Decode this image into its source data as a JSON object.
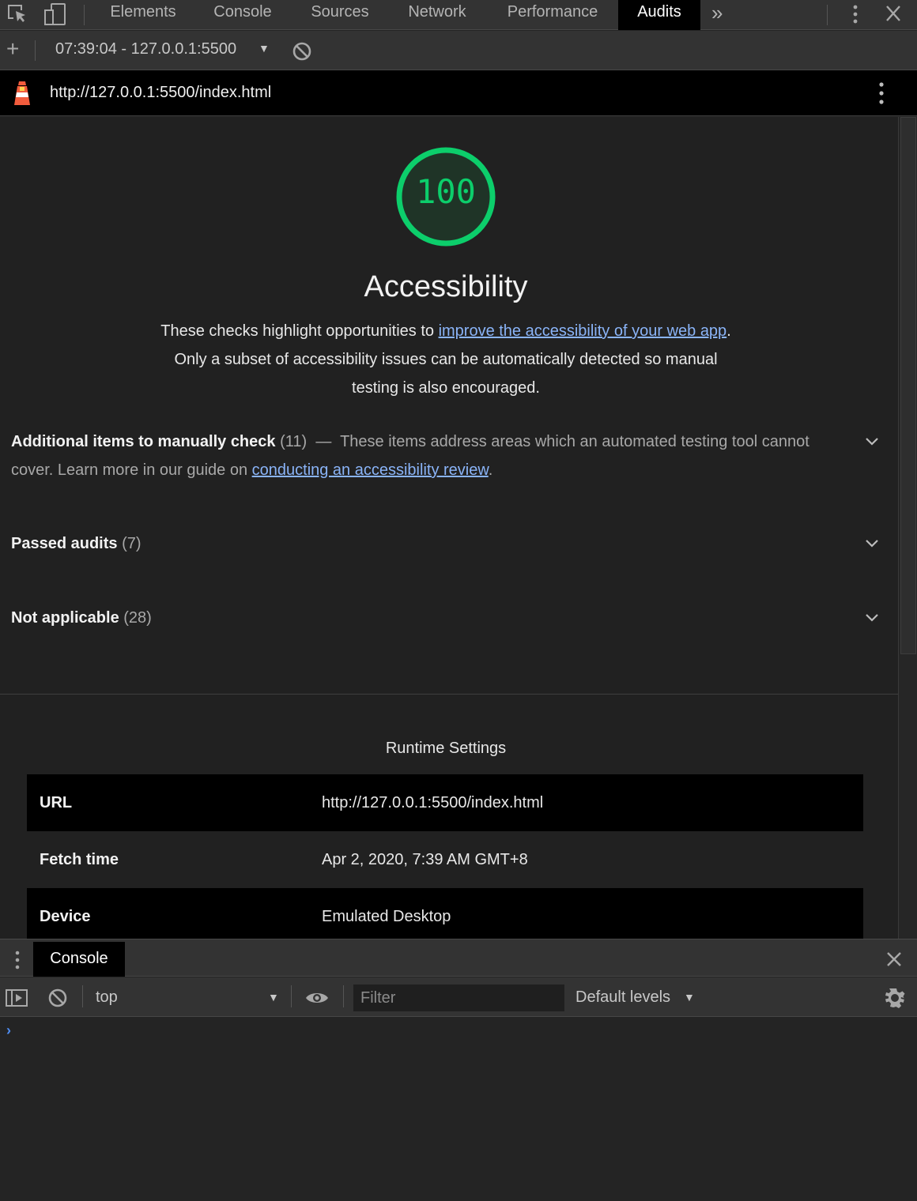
{
  "devtools": {
    "tabs": [
      "Elements",
      "Console",
      "Sources",
      "Network",
      "Performance",
      "Audits"
    ],
    "active_tab": "Audits",
    "more_tabs_glyph": "»"
  },
  "report_bar": {
    "new_audit_glyph": "+",
    "selected_report": "07:39:04 - 127.0.0.1:5500"
  },
  "lighthouse_header": {
    "url": "http://127.0.0.1:5500/index.html"
  },
  "category": {
    "score": "100",
    "score_color": "#0cce6b",
    "title": "Accessibility",
    "desc_before": "These checks highlight opportunities to ",
    "desc_link": "improve the accessibility of your web app",
    "desc_after": ". Only a subset of accessibility issues can be automatically detected so manual testing is also encouraged."
  },
  "groups": {
    "manual": {
      "title": "Additional items to manually check",
      "count": "(11)",
      "separator": "—",
      "desc_before": "These items address areas which an automated testing tool cannot cover. Learn more in our guide on ",
      "desc_link": "conducting an accessibility review",
      "desc_after": "."
    },
    "passed": {
      "title": "Passed audits",
      "count": "(7)"
    },
    "not_applicable": {
      "title": "Not applicable",
      "count": "(28)"
    }
  },
  "runtime_settings": {
    "title": "Runtime Settings",
    "rows": [
      {
        "key": "URL",
        "value": "http://127.0.0.1:5500/index.html"
      },
      {
        "key": "Fetch time",
        "value": "Apr 2, 2020, 7:39 AM GMT+8"
      },
      {
        "key": "Device",
        "value": "Emulated Desktop"
      }
    ]
  },
  "drawer": {
    "tab_label": "Console",
    "context": "top",
    "filter_placeholder": "Filter",
    "levels": "Default levels",
    "prompt_glyph": "›"
  }
}
